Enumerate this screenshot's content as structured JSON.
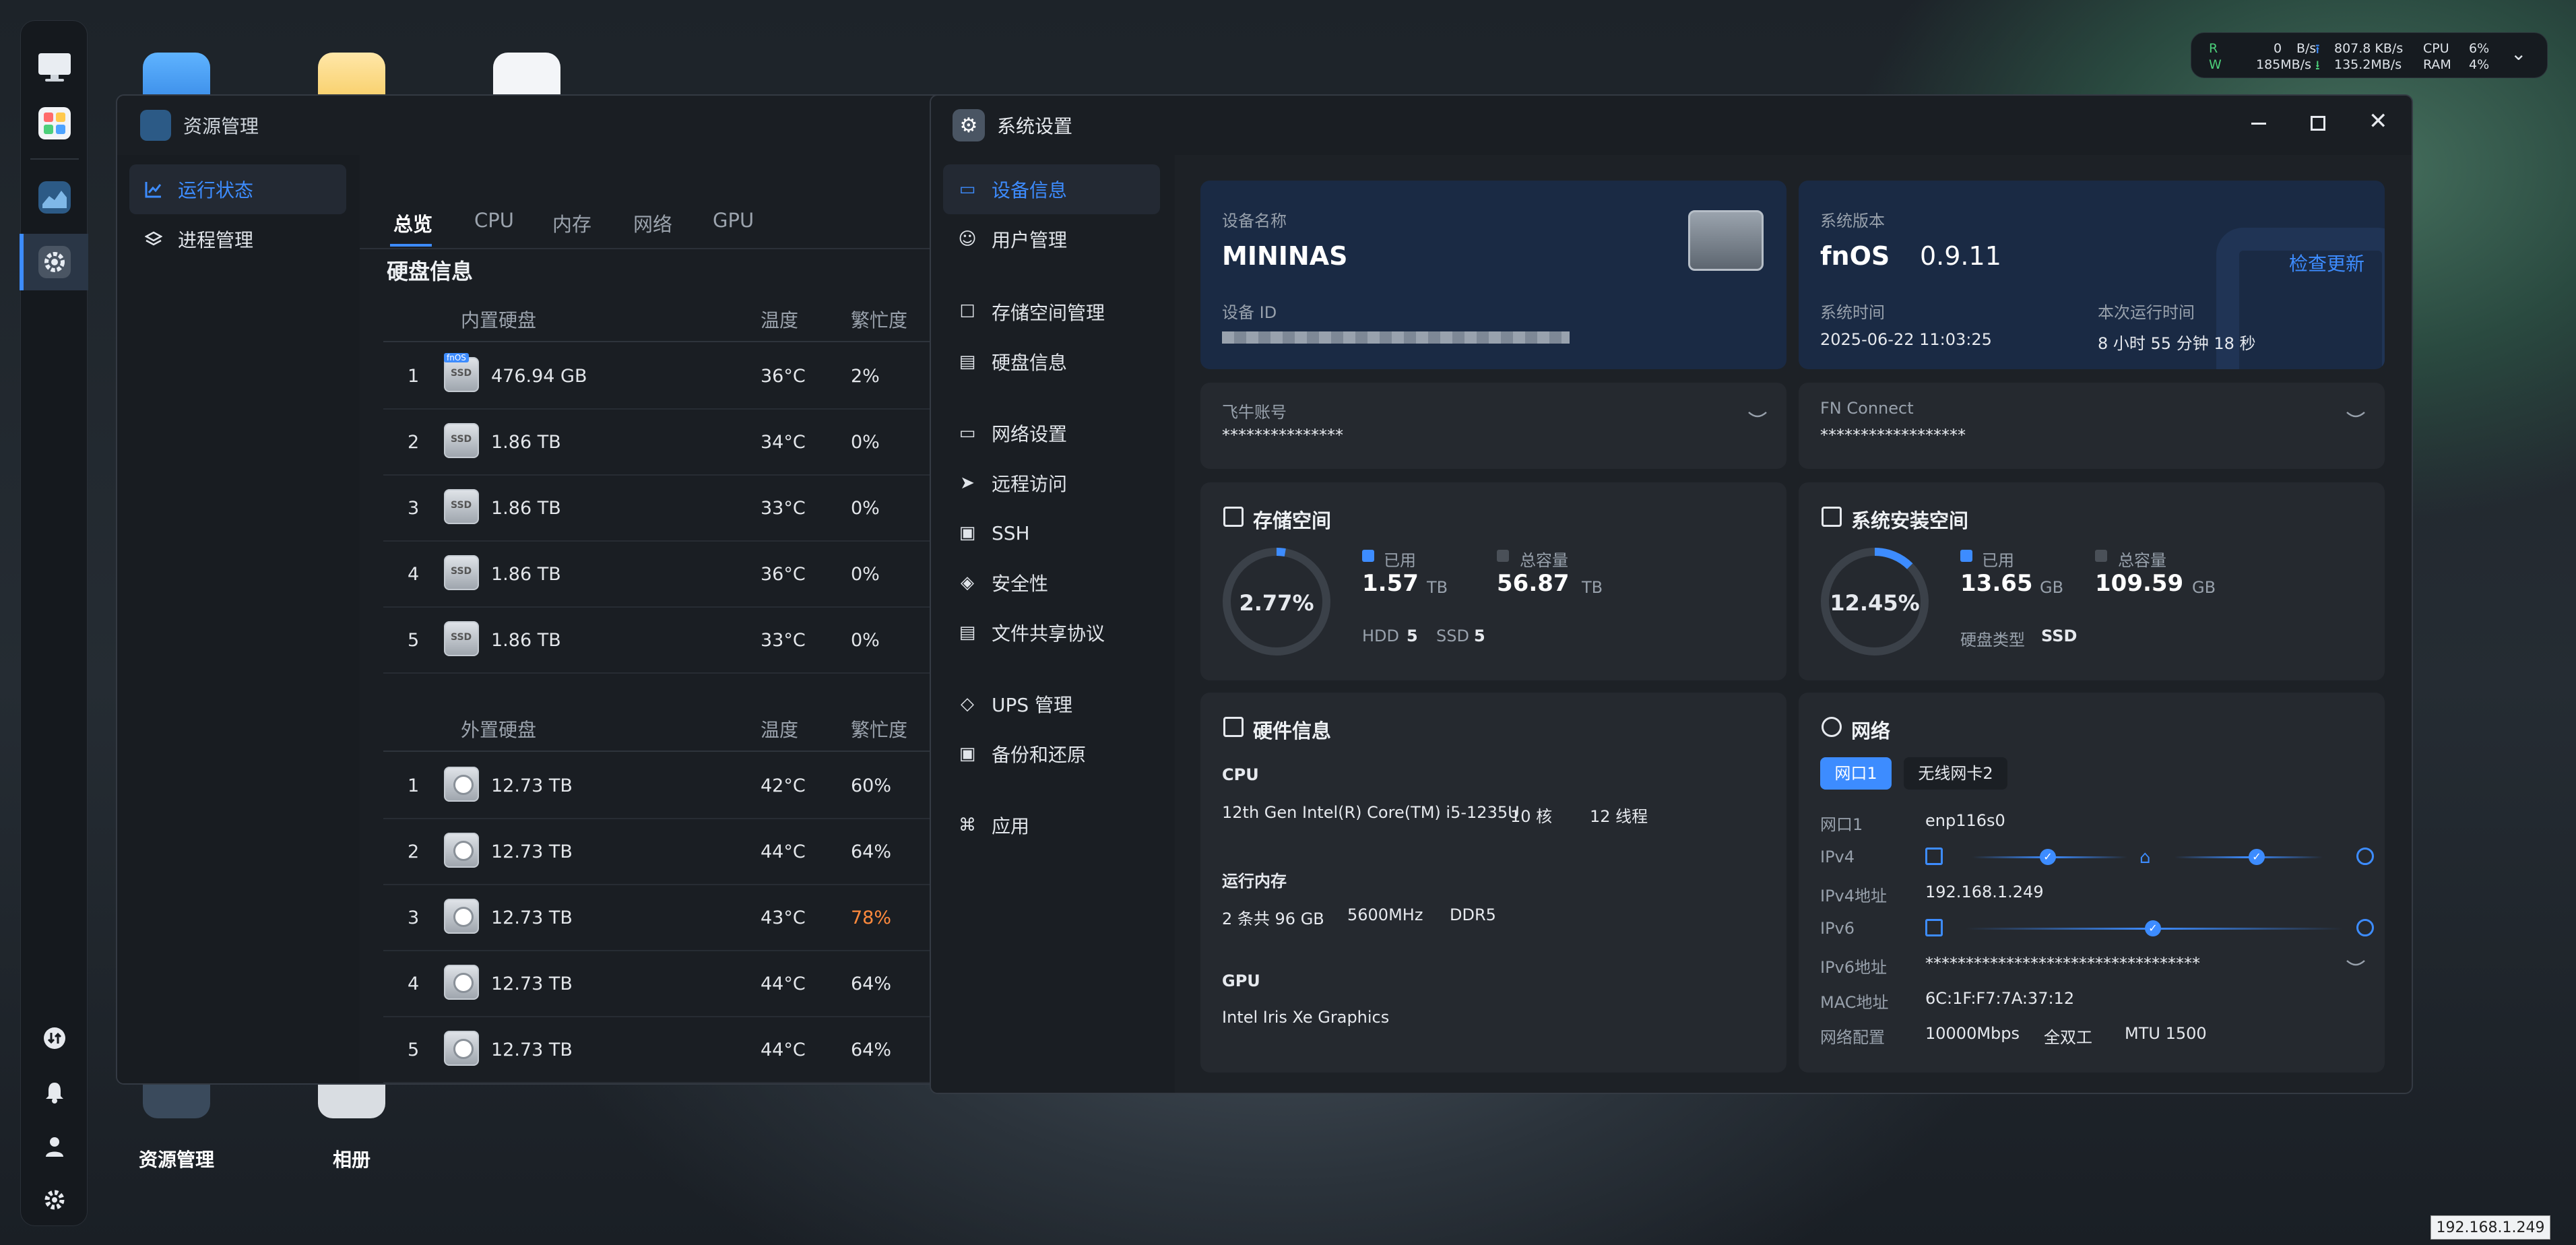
{
  "topstats": {
    "r_label": "R",
    "w_label": "W",
    "r_val": "0",
    "r_unit": "B/s",
    "w_val": "185MB/s",
    "up_val": "807.8 KB/s",
    "down_val": "135.2MB/s",
    "cpu_label": "CPU",
    "ram_label": "RAM",
    "cpu_val": "6%",
    "ram_val": "4%"
  },
  "desktop": {
    "icon1_label": "资源管理",
    "icon2_label": "相册"
  },
  "ip_badge": "192.168.1.249",
  "res_win": {
    "title": "资源管理",
    "side": [
      {
        "label": "运行状态"
      },
      {
        "label": "进程管理"
      }
    ],
    "tabs": [
      "总览",
      "CPU",
      "内存",
      "网络",
      "GPU"
    ],
    "section_title": "硬盘信息",
    "internal": {
      "header": [
        "内置硬盘",
        "温度",
        "繁忙度"
      ],
      "rows": [
        {
          "n": "1",
          "size": "476.94 GB",
          "temp": "36°C",
          "busy": "2%",
          "badge": "fnOS"
        },
        {
          "n": "2",
          "size": "1.86 TB",
          "temp": "34°C",
          "busy": "0%"
        },
        {
          "n": "3",
          "size": "1.86 TB",
          "temp": "33°C",
          "busy": "0%"
        },
        {
          "n": "4",
          "size": "1.86 TB",
          "temp": "36°C",
          "busy": "0%"
        },
        {
          "n": "5",
          "size": "1.86 TB",
          "temp": "33°C",
          "busy": "0%"
        }
      ]
    },
    "external": {
      "header": [
        "外置硬盘",
        "温度",
        "繁忙度"
      ],
      "rows": [
        {
          "n": "1",
          "size": "12.73 TB",
          "temp": "42°C",
          "busy": "60%"
        },
        {
          "n": "2",
          "size": "12.73 TB",
          "temp": "44°C",
          "busy": "64%"
        },
        {
          "n": "3",
          "size": "12.73 TB",
          "temp": "43°C",
          "busy": "78%"
        },
        {
          "n": "4",
          "size": "12.73 TB",
          "temp": "44°C",
          "busy": "64%"
        },
        {
          "n": "5",
          "size": "12.73 TB",
          "temp": "44°C",
          "busy": "64%"
        }
      ]
    }
  },
  "sys_win": {
    "title": "系统设置",
    "side": [
      {
        "label": "设备信息"
      },
      {
        "label": "用户管理"
      },
      {
        "label": "存储空间管理"
      },
      {
        "label": "硬盘信息"
      },
      {
        "label": "网络设置"
      },
      {
        "label": "远程访问"
      },
      {
        "label": "SSH"
      },
      {
        "label": "安全性"
      },
      {
        "label": "文件共享协议"
      },
      {
        "label": "UPS 管理"
      },
      {
        "label": "备份和还原"
      },
      {
        "label": "应用"
      }
    ],
    "device": {
      "name_label": "设备名称",
      "name": "MININAS",
      "id_label": "设备 ID"
    },
    "version": {
      "label": "系统版本",
      "os": "fnOS",
      "ver": "0.9.11",
      "check": "检查更新",
      "time_label": "系统时间",
      "time": "2025-06-22 11:03:25",
      "uptime_label": "本次运行时间",
      "uptime": "8 小时 55 分钟 18 秒"
    },
    "account": {
      "label": "飞牛账号",
      "value": "***************"
    },
    "fnconnect": {
      "label": "FN Connect",
      "value": "******************"
    },
    "storage": {
      "title": "存储空间",
      "pct": "2.77%",
      "pct_value": 0.0277,
      "used_label": "已用",
      "used": "1.57",
      "used_unit": "TB",
      "total_label": "总容量",
      "total": "56.87",
      "total_unit": "TB",
      "hdd_label": "HDD",
      "hdd": "5",
      "ssd_label": "SSD",
      "ssd": "5"
    },
    "sysdisk": {
      "title": "系统安装空间",
      "pct": "12.45%",
      "pct_value": 0.1245,
      "used_label": "已用",
      "used": "13.65",
      "used_unit": "GB",
      "total_label": "总容量",
      "total": "109.59",
      "total_unit": "GB",
      "type_label": "硬盘类型",
      "type": "SSD"
    },
    "hardware": {
      "title": "硬件信息",
      "cpu_label": "CPU",
      "cpu": "12th Gen Intel(R) Core(TM) i5-1235U",
      "cores": "10 核",
      "threads": "12 线程",
      "mem_label": "运行内存",
      "mem": "2 条共 96 GB",
      "mem_speed": "5600MHz",
      "mem_type": "DDR5",
      "gpu_label": "GPU",
      "gpu": "Intel Iris Xe Graphics"
    },
    "network": {
      "title": "网络",
      "tab1": "网口1",
      "tab2": "无线网卡2",
      "port_label": "网口1",
      "port": "enp116s0",
      "ipv4_label": "IPv4",
      "ipv4addr_label": "IPv4地址",
      "ipv4addr": "192.168.1.249",
      "ipv6_label": "IPv6",
      "ipv6addr_label": "IPv6地址",
      "ipv6addr": "**********************************",
      "mac_label": "MAC地址",
      "mac": "6C:1F:F7:7A:37:12",
      "cfg_label": "网络配置",
      "speed": "10000Mbps",
      "duplex": "全双工",
      "mtu": "MTU 1500"
    }
  },
  "colors": {
    "accent": "#3d8cff",
    "warn": "#ff8a3d",
    "card": "#25292f",
    "card_blue": "#1a2a44"
  }
}
